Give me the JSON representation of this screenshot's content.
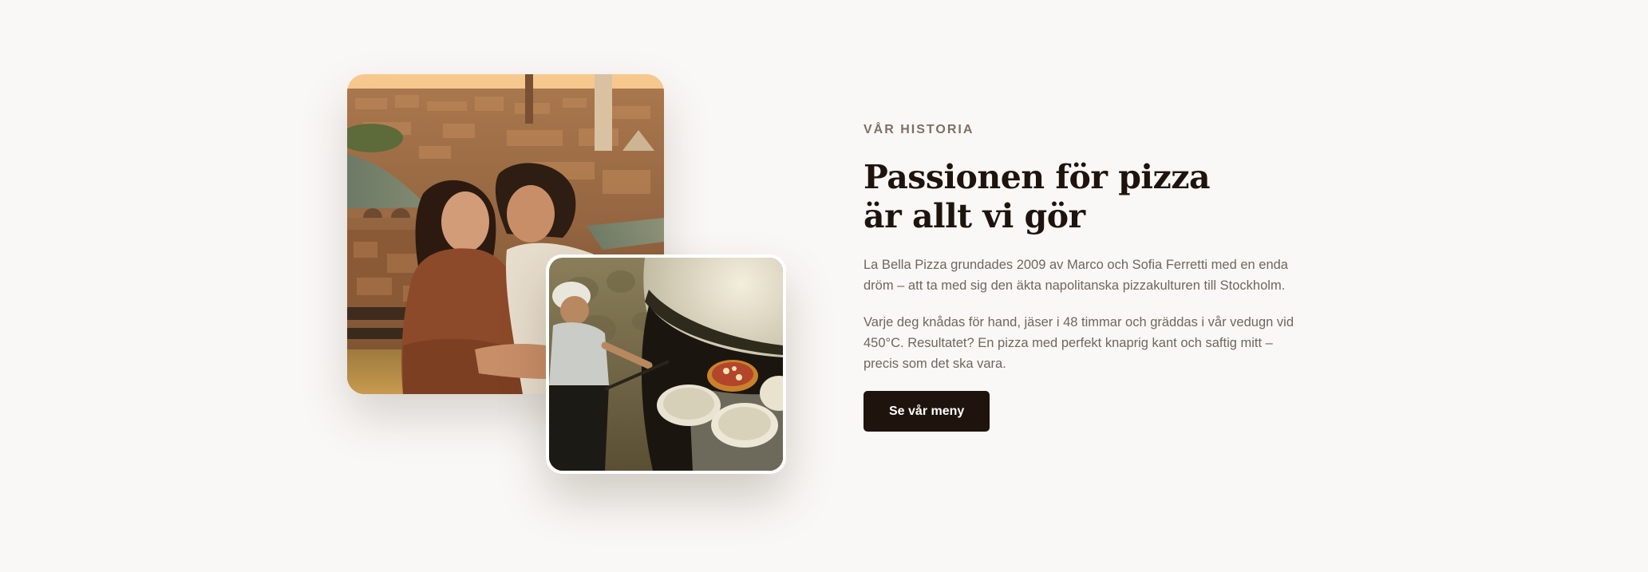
{
  "story": {
    "eyebrow": "VÅR HISTORIA",
    "heading_line_1": "Passionen för pizza",
    "heading_line_2": "är allt vi gör",
    "paragraph_1": "La Bella Pizza grundades 2009 av Marco och Sofia Ferretti med en enda dröm – att ta med sig den äkta napolitanska pizzakulturen till Stockholm.",
    "paragraph_2": "Varje deg knådas för hand, jäser i 48 timmar och gräddas i vår vedugn vid 450°C. Resultatet? En pizza med perfekt knaprig kant och saftig mitt – precis som det ska vara.",
    "cta_label": "Se vår meny"
  },
  "images": {
    "main": "couple-over-italian-city-photo",
    "secondary": "pizzaiolo-wood-fired-oven-photo"
  },
  "colors": {
    "background": "#faf8f6",
    "heading": "#1e140d",
    "body_text": "#6f665e",
    "eyebrow": "#7d7064",
    "button_bg": "#1e140d",
    "button_text": "#ffffff"
  }
}
